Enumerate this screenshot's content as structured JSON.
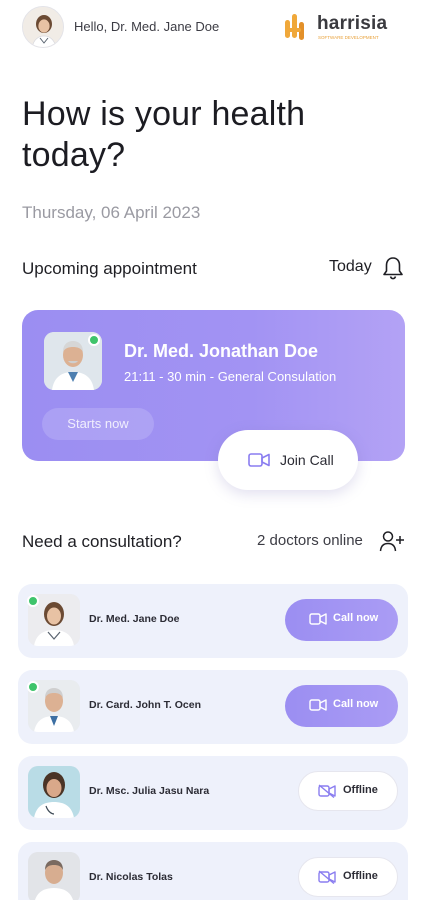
{
  "header": {
    "greeting": "Hello, Dr. Med. Jane Doe",
    "logo_text": "harrisia",
    "logo_tagline": "SOFTWARE DEVELOPMENT"
  },
  "hero": {
    "title": "How is your health today?",
    "date": "Thursday, 06 April 2023"
  },
  "appointment_section": {
    "title": "Upcoming appointment",
    "filter_label": "Today"
  },
  "appointment": {
    "doctor_name": "Dr. Med. Jonathan Doe",
    "details": "21:11 - 30 min - General Consulation",
    "starts_label": "Starts now",
    "join_label": "Join Call"
  },
  "consultation_section": {
    "title": "Need a consultation?",
    "online_count": "2 doctors online"
  },
  "doctors": [
    {
      "name": "Dr. Med. Jane Doe",
      "online": true,
      "action_label": "Call now"
    },
    {
      "name": "Dr. Card. John T. Ocen",
      "online": true,
      "action_label": "Call now"
    },
    {
      "name": "Dr. Msc. Julia Jasu Nara",
      "online": false,
      "action_label": "Offline"
    },
    {
      "name": "Dr. Nicolas Tolas",
      "online": false,
      "action_label": "Offline"
    }
  ],
  "icons": {
    "bell": "bell-icon",
    "video": "video-camera-icon",
    "video_off": "video-off-icon",
    "add_user": "add-user-icon"
  },
  "colors": {
    "accent": "#9b8ef2",
    "online": "#3fc46b",
    "card_bg": "#eef1fb",
    "brand_orange": "#e8a13a"
  }
}
